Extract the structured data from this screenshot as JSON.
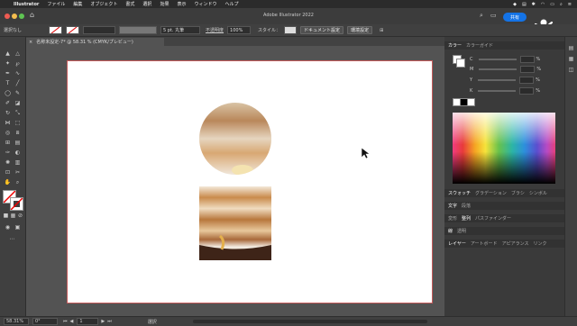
{
  "menubar": {
    "items": [
      "Illustrator",
      "ファイル",
      "編集",
      "オブジェクト",
      "書式",
      "選択",
      "効果",
      "表示",
      "ウィンドウ",
      "ヘルプ"
    ]
  },
  "window": {
    "title": "Adobe Illustrator 2022",
    "share_label": "共有"
  },
  "control": {
    "selection_label": "選択なし",
    "stroke_weight": "5 pt. 丸筆",
    "opacity_label": "不透明度",
    "opacity_value": "100%",
    "style_label": "スタイル：",
    "doc_setup_button": "ドキュメント設定",
    "prefs_button": "環境設定"
  },
  "document": {
    "tab_label": "名称未設定-7* @ 58.31 % (CMYK/プレビュー)",
    "close_glyph": "×"
  },
  "color_panel": {
    "tabs": [
      "カラー",
      "カラーガイド"
    ],
    "rows": [
      {
        "label": "C",
        "unit": "%"
      },
      {
        "label": "M",
        "unit": "%"
      },
      {
        "label": "Y",
        "unit": "%"
      },
      {
        "label": "K",
        "unit": "%"
      }
    ]
  },
  "swatch_panel": {
    "tabs": [
      "スウォッチ",
      "グラデーション",
      "ブラシ",
      "シンボル"
    ]
  },
  "type_panel": {
    "tabs": [
      "文字",
      "段落"
    ]
  },
  "transform_panel": {
    "tabs": [
      "変形",
      "整列",
      "パスファインダー"
    ]
  },
  "appearance_panel": {
    "tabs": [
      "線",
      "透明"
    ]
  },
  "layers_panel": {
    "tabs": [
      "レイヤー",
      "アートボード",
      "アピアランス",
      "リンク"
    ]
  },
  "statusbar": {
    "zoom": "58.31%",
    "rotation": "0°",
    "artboard_num": "1",
    "mode": "選択"
  },
  "colors": {
    "accent": "#1473e6",
    "artboard_border": "#c45a5a"
  }
}
